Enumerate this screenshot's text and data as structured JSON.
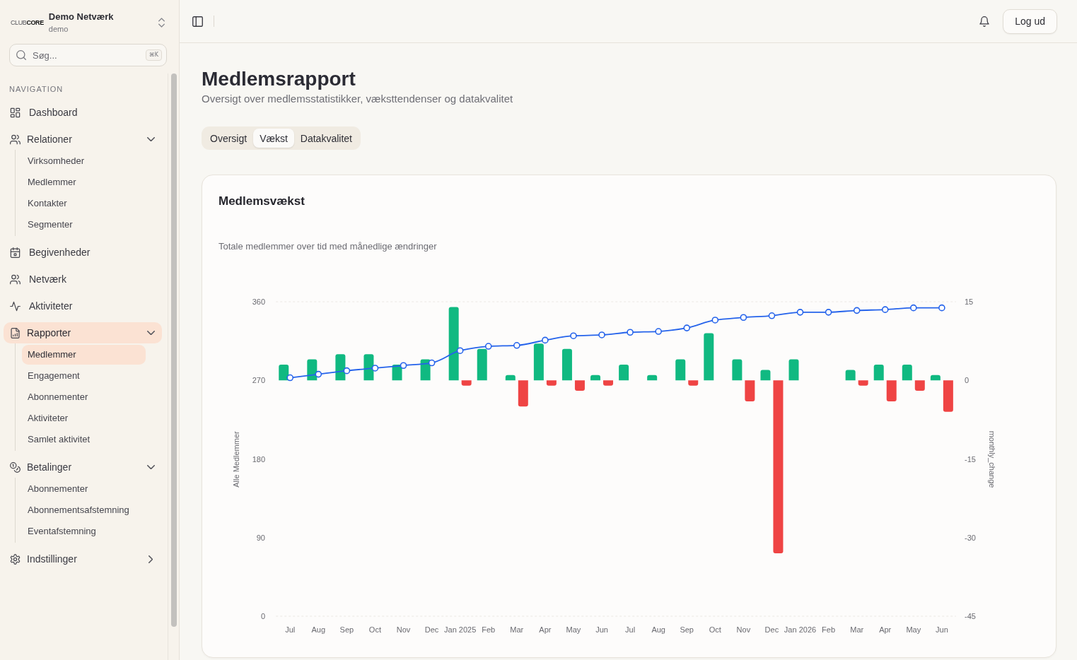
{
  "sidebar": {
    "logo": "CLUB**CORE**",
    "workspace": {
      "name": "Demo Netværk",
      "subtitle": "demo"
    },
    "search": {
      "placeholder": "Søg...",
      "shortcut": "⌘K"
    },
    "section_label": "NAVIGATION",
    "items": [
      {
        "kind": "link",
        "label": "Dashboard",
        "selected": false
      },
      {
        "kind": "group",
        "label": "Relationer",
        "selected": false,
        "expanded": true,
        "children": [
          {
            "label": "Virksomheder",
            "selected": false
          },
          {
            "label": "Medlemmer",
            "selected": false
          },
          {
            "label": "Kontakter",
            "selected": false
          },
          {
            "label": "Segmenter",
            "selected": false
          }
        ]
      },
      {
        "kind": "link",
        "label": "Begivenheder",
        "selected": false
      },
      {
        "kind": "link",
        "label": "Netværk",
        "selected": false
      },
      {
        "kind": "link",
        "label": "Aktiviteter",
        "selected": false
      },
      {
        "kind": "group",
        "label": "Rapporter",
        "selected": true,
        "expanded": true,
        "children": [
          {
            "label": "Medlemmer",
            "selected": true
          },
          {
            "label": "Engagement",
            "selected": false
          },
          {
            "label": "Abonnementer",
            "selected": false
          },
          {
            "label": "Aktiviteter",
            "selected": false
          },
          {
            "label": "Samlet aktivitet",
            "selected": false
          }
        ]
      },
      {
        "kind": "group",
        "label": "Betalinger",
        "selected": false,
        "expanded": true,
        "children": [
          {
            "label": "Abonnementer",
            "selected": false
          },
          {
            "label": "Abonnementsafstemning",
            "selected": false
          },
          {
            "label": "Eventafstemning",
            "selected": false
          }
        ]
      },
      {
        "kind": "group",
        "label": "Indstillinger",
        "selected": false,
        "expanded": false
      }
    ]
  },
  "topbar": {
    "logout_button": "Log ud"
  },
  "page": {
    "title": "Medlemsrapport",
    "subtitle": "Oversigt over medlemsstatistikker, væksttendenser og datakvalitet",
    "tabs": [
      {
        "label": "Oversigt",
        "selected": false
      },
      {
        "label": "Vækst",
        "selected": true
      },
      {
        "label": "Datakvalitet",
        "selected": false
      }
    ]
  },
  "card": {
    "title": "Medlemsvækst",
    "description": "Totale medlemmer over tid med månedlige ændringer",
    "chart_data": {
      "type": "bar",
      "categories": [
        "Jul",
        "Aug",
        "Sep",
        "Oct",
        "Nov",
        "Dec",
        "Jan 2025",
        "Feb",
        "Mar",
        "Apr",
        "May",
        "Jun",
        "Jul",
        "Aug",
        "Sep",
        "Oct",
        "Nov",
        "Dec",
        "Jan 2026",
        "Feb",
        "Mar",
        "Apr",
        "May",
        "Jun"
      ],
      "ylabel": "Alle Medlemmer",
      "ylim": [
        0,
        360
      ],
      "yticks": [
        0,
        90,
        180,
        270,
        360
      ],
      "y2label": "monthly_change",
      "y2lim": [
        -45,
        15
      ],
      "y2ticks": [
        -45,
        -30,
        -15,
        0,
        15
      ],
      "series": [
        {
          "axis": "y2",
          "color": "#10b981",
          "values": [
            3,
            4,
            5,
            5,
            3,
            4,
            14,
            6,
            1,
            7,
            6,
            1,
            3,
            1,
            4,
            9,
            4,
            2,
            4,
            0,
            2,
            3,
            3,
            1
          ]
        },
        {
          "axis": "y2",
          "color": "#ef4444",
          "values": [
            0,
            0,
            0,
            0,
            0,
            0,
            -1,
            0,
            -5,
            -1,
            -2,
            -1,
            0,
            0,
            -1,
            0,
            -4,
            -33,
            0,
            0,
            -1,
            -4,
            -2,
            -6
          ]
        },
        {
          "type": "line",
          "color": "#2563eb",
          "marker": "circle",
          "values": [
            273,
            277,
            281,
            284,
            287,
            290,
            304,
            309,
            310,
            316,
            321,
            322,
            325,
            326,
            330,
            339,
            342,
            344,
            348,
            348,
            350,
            351,
            353,
            353
          ]
        }
      ]
    }
  }
}
